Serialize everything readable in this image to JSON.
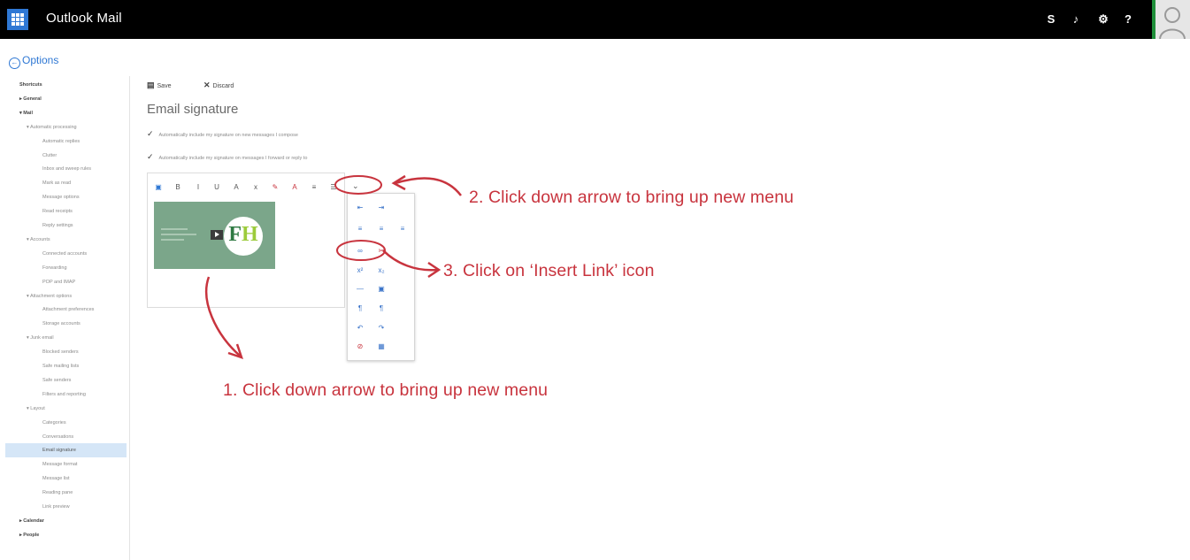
{
  "header": {
    "app_title": "Outlook Mail",
    "icons": [
      {
        "name": "skype-icon",
        "glyph": "S"
      },
      {
        "name": "notifications-bell-icon",
        "glyph": "♪"
      },
      {
        "name": "settings-gear-icon",
        "glyph": "⚙"
      },
      {
        "name": "help-icon",
        "glyph": "?"
      }
    ],
    "accent_color": "#2f78d4"
  },
  "options": {
    "label": "Options"
  },
  "sidebar": {
    "items": [
      {
        "label": "Shortcuts",
        "level": 0
      },
      {
        "label": "▸ General",
        "level": 0
      },
      {
        "label": "▾ Mail",
        "level": 0
      },
      {
        "label": "▾ Automatic processing",
        "level": 1
      },
      {
        "label": "Automatic replies",
        "level": 2
      },
      {
        "label": "Clutter",
        "level": 2
      },
      {
        "label": "Inbox and sweep rules",
        "level": 2
      },
      {
        "label": "Mark as read",
        "level": 2
      },
      {
        "label": "Message options",
        "level": 2
      },
      {
        "label": "Read receipts",
        "level": 2
      },
      {
        "label": "Reply settings",
        "level": 2
      },
      {
        "label": "▾ Accounts",
        "level": 1
      },
      {
        "label": "Connected accounts",
        "level": 2
      },
      {
        "label": "Forwarding",
        "level": 2
      },
      {
        "label": "POP and IMAP",
        "level": 2
      },
      {
        "label": "▾ Attachment options",
        "level": 1
      },
      {
        "label": "Attachment preferences",
        "level": 2
      },
      {
        "label": "Storage accounts",
        "level": 2
      },
      {
        "label": "▾ Junk email",
        "level": 1
      },
      {
        "label": "Blocked senders",
        "level": 2
      },
      {
        "label": "Safe mailing lists",
        "level": 2
      },
      {
        "label": "Safe senders",
        "level": 2
      },
      {
        "label": "Filters and reporting",
        "level": 2
      },
      {
        "label": "▾ Layout",
        "level": 1
      },
      {
        "label": "Categories",
        "level": 2
      },
      {
        "label": "Conversations",
        "level": 2
      },
      {
        "label": "Email signature",
        "level": 2,
        "selected": true
      },
      {
        "label": "Message format",
        "level": 2
      },
      {
        "label": "Message list",
        "level": 2
      },
      {
        "label": "Reading pane",
        "level": 2
      },
      {
        "label": "Link preview",
        "level": 2
      },
      {
        "label": "▸ Calendar",
        "level": 0
      },
      {
        "label": "▸ People",
        "level": 0
      }
    ]
  },
  "commands": {
    "save": "Save",
    "discard": "Discard"
  },
  "main": {
    "heading": "Email signature",
    "checkbox_new": "Automatically include my signature on new messages I compose",
    "checkbox_reply": "Automatically include my signature on messages I forward or reply to"
  },
  "editor": {
    "toolbar": [
      {
        "name": "insert-picture-icon",
        "glyph": "▣"
      },
      {
        "name": "bold-icon",
        "glyph": "B"
      },
      {
        "name": "italic-icon",
        "glyph": "I"
      },
      {
        "name": "underline-icon",
        "glyph": "U"
      },
      {
        "name": "font-size-icon",
        "glyph": "A"
      },
      {
        "name": "subscript-icon",
        "glyph": "x"
      },
      {
        "name": "highlight-icon",
        "glyph": "✎"
      },
      {
        "name": "font-color-icon",
        "glyph": "A"
      },
      {
        "name": "bullets-icon",
        "glyph": "≡"
      },
      {
        "name": "numbering-icon",
        "glyph": "☰"
      }
    ],
    "more_glyph": "⌄",
    "signature_logo_text": [
      "F",
      "H"
    ]
  },
  "more_menu": {
    "items": [
      {
        "name": "decrease-indent-icon",
        "glyph": "⇤"
      },
      {
        "name": "increase-indent-icon",
        "glyph": "⇥"
      },
      {
        "name": "align-left-icon",
        "glyph": "≡"
      },
      {
        "name": "align-center-icon",
        "glyph": "≡"
      },
      {
        "name": "align-right-icon",
        "glyph": "≡"
      },
      {
        "name": "insert-link-icon",
        "glyph": "∞"
      },
      {
        "name": "remove-link-icon",
        "glyph": "✂"
      },
      {
        "name": "superscript-icon",
        "glyph": "x²"
      },
      {
        "name": "subscript-alt-icon",
        "glyph": "x₂"
      },
      {
        "name": "horizontal-line-icon",
        "glyph": "—"
      },
      {
        "name": "insert-image-icon",
        "glyph": "▣"
      },
      {
        "name": "left-to-right-icon",
        "glyph": "¶"
      },
      {
        "name": "right-to-left-icon",
        "glyph": "¶"
      },
      {
        "name": "undo-icon",
        "glyph": "↶"
      },
      {
        "name": "redo-icon",
        "glyph": "↷"
      },
      {
        "name": "clear-formatting-icon",
        "glyph": "⊘"
      },
      {
        "name": "insert-table-icon",
        "glyph": "▦"
      }
    ]
  },
  "annotations": {
    "step1": "1. Click down arrow to bring up new menu",
    "step2": "2. Click down arrow to bring up new menu",
    "step3": "3. Click on ‘Insert Link’ icon",
    "color": "#c8343e"
  }
}
